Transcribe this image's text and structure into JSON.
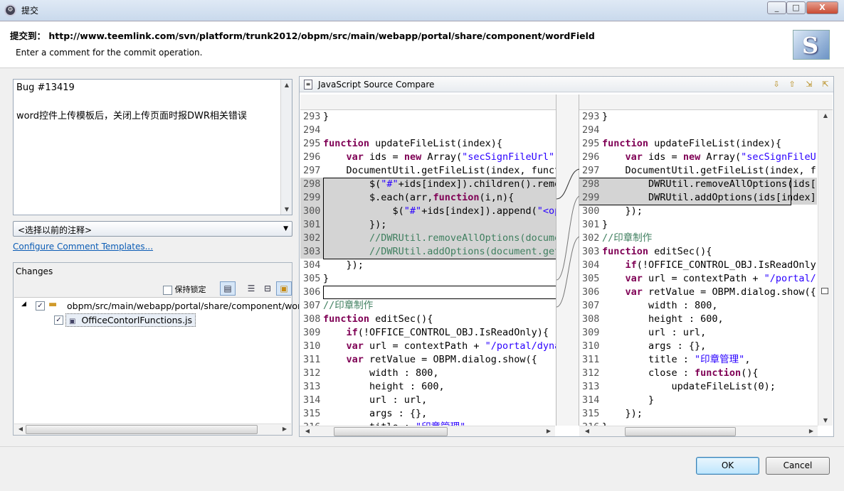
{
  "window": {
    "title": "提交",
    "buttons": {
      "minimize": "_",
      "maximize": "□",
      "close": "X"
    }
  },
  "header": {
    "title": "提交到： http://www.teemlink.com/svn/platform/trunk2012/obpm/src/main/webapp/portal/share/component/wordField",
    "subtitle": "Enter a comment for the commit operation."
  },
  "comment": {
    "line1": "Bug #13419",
    "line2": "word控件上传模板后，关闭上传页面时报DWR相关错误"
  },
  "previous_comments": {
    "selected": "<选择以前的注释>"
  },
  "configure_link": "Configure Comment Templates...",
  "changes": {
    "title": "Changes",
    "keep_locks_label": "保持锁定",
    "folder_path": "obpm/src/main/webapp/portal/share/component/wor",
    "file_name": "OfficeContorlFunctions.js"
  },
  "compare": {
    "title": "JavaScript Source Compare",
    "left_lines": [
      {
        "n": "293",
        "t": "}"
      },
      {
        "n": "294",
        "t": ""
      },
      {
        "n": "295",
        "t": "function updateFileList(index){"
      },
      {
        "n": "296",
        "t": "    var ids = new Array(\"secSignFileUrl\","
      },
      {
        "n": "297",
        "t": "    DocumentUtil.getFileList(index, funct"
      },
      {
        "n": "298",
        "t": "        $(\"#\"+ids[index]).children().remo"
      },
      {
        "n": "299",
        "t": "        $.each(arr,function(i,n){"
      },
      {
        "n": "300",
        "t": "            $(\"#\"+ids[index]).append(\"<op"
      },
      {
        "n": "301",
        "t": "        });"
      },
      {
        "n": "302",
        "t": "        //DWRUtil.removeAllOptions(docume"
      },
      {
        "n": "303",
        "t": "        //DWRUtil.addOptions(document.get"
      },
      {
        "n": "304",
        "t": "    });"
      },
      {
        "n": "305",
        "t": "}"
      },
      {
        "n": "306",
        "t": ""
      },
      {
        "n": "307",
        "t": "//印章制作"
      },
      {
        "n": "308",
        "t": "function editSec(){"
      },
      {
        "n": "309",
        "t": "    if(!OFFICE_CONTROL_OBJ.IsReadOnly){"
      },
      {
        "n": "310",
        "t": "    var url = contextPath + \"/portal/dyna"
      },
      {
        "n": "311",
        "t": "    var retValue = OBPM.dialog.show({"
      },
      {
        "n": "312",
        "t": "        width : 800,"
      },
      {
        "n": "313",
        "t": "        height : 600,"
      },
      {
        "n": "314",
        "t": "        url : url,"
      },
      {
        "n": "315",
        "t": "        args : {},"
      },
      {
        "n": "316",
        "t": "        title : \"印章管理\","
      }
    ],
    "right_lines": [
      {
        "n": "293",
        "t": "}"
      },
      {
        "n": "294",
        "t": ""
      },
      {
        "n": "295",
        "t": "function updateFileList(index){"
      },
      {
        "n": "296",
        "t": "    var ids = new Array(\"secSignFileU"
      },
      {
        "n": "297",
        "t": "    DocumentUtil.getFileList(index, f"
      },
      {
        "n": "298",
        "t": "        DWRUtil.removeAllOptions(ids["
      },
      {
        "n": "299",
        "t": "        DWRUtil.addOptions(ids[index]"
      },
      {
        "n": "300",
        "t": "    });"
      },
      {
        "n": "301",
        "t": "}"
      },
      {
        "n": "302",
        "t": "//印章制作"
      },
      {
        "n": "303",
        "t": "function editSec(){"
      },
      {
        "n": "304",
        "t": "    if(!OFFICE_CONTROL_OBJ.IsReadOnly"
      },
      {
        "n": "305",
        "t": "    var url = contextPath + \"/portal/"
      },
      {
        "n": "306",
        "t": "    var retValue = OBPM.dialog.show({"
      },
      {
        "n": "307",
        "t": "        width : 800,"
      },
      {
        "n": "308",
        "t": "        height : 600,"
      },
      {
        "n": "309",
        "t": "        url : url,"
      },
      {
        "n": "310",
        "t": "        args : {},"
      },
      {
        "n": "311",
        "t": "        title : \"印章管理\","
      },
      {
        "n": "312",
        "t": "        close : function(){"
      },
      {
        "n": "313",
        "t": "            updateFileList(0);"
      },
      {
        "n": "314",
        "t": "        }"
      },
      {
        "n": "315",
        "t": "    });"
      },
      {
        "n": "316",
        "t": "}"
      }
    ],
    "left_highlight": [
      298,
      299,
      300,
      301,
      302,
      303
    ],
    "right_highlight": [
      298,
      299
    ]
  },
  "footer": {
    "ok_label": "OK",
    "cancel_label": "Cancel"
  }
}
